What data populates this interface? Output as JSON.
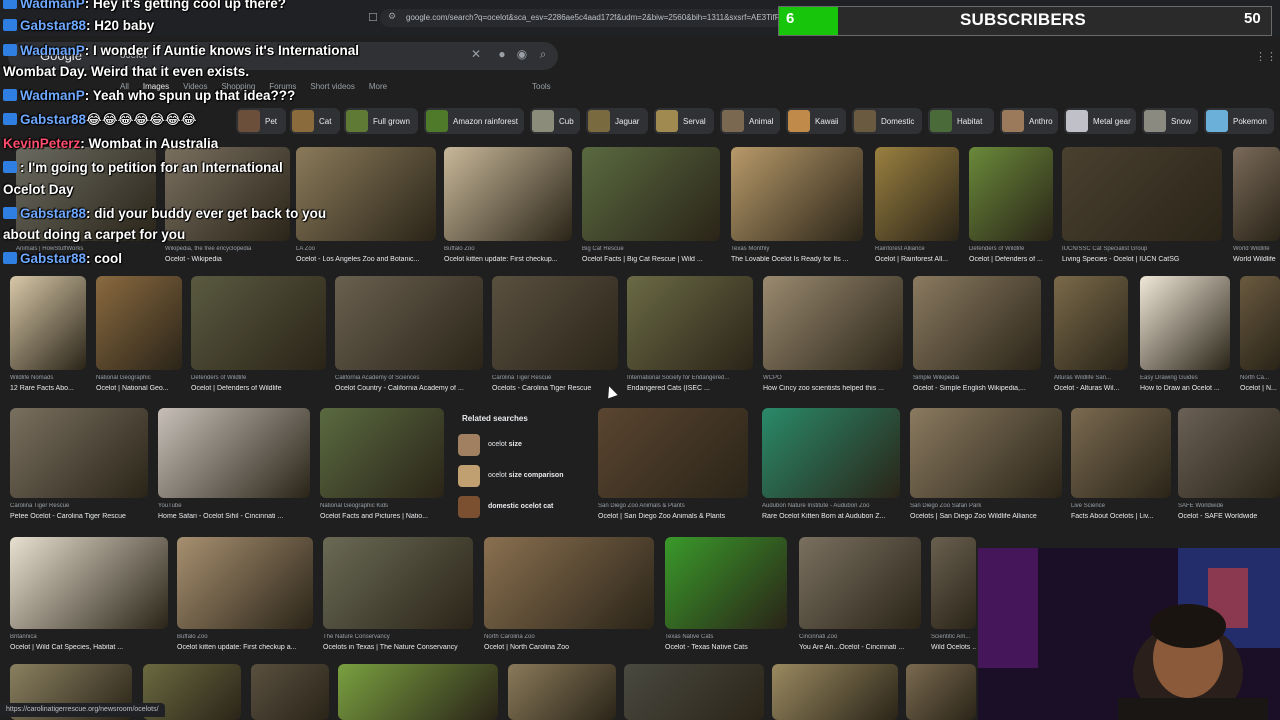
{
  "browser": {
    "url": "google.com/search?q=ocelot&sca_esv=2286ae5c4aad172f&udm=2&biw=2560&bih=1311&sxsrf=AE3TifP9aw7SG",
    "status_url": "https://carolinatigerrescue.org/newsroom/ocelots/"
  },
  "google": {
    "logo": "Google",
    "query": "ocelot",
    "tabs": [
      "All",
      "Images",
      "Videos",
      "Shopping",
      "Forums",
      "Short videos",
      "More"
    ],
    "tools": "Tools"
  },
  "chips": [
    {
      "label": "Pet",
      "color": "#6b4f3a"
    },
    {
      "label": "Cat",
      "color": "#8a6b3b"
    },
    {
      "label": "Full grown",
      "color": "#5e7a35"
    },
    {
      "label": "Amazon rainforest",
      "color": "#4f7a2a"
    },
    {
      "label": "Cub",
      "color": "#8c8c7a"
    },
    {
      "label": "Jaguar",
      "color": "#7a6a40"
    },
    {
      "label": "Serval",
      "color": "#a08a50"
    },
    {
      "label": "Animal",
      "color": "#7a6850"
    },
    {
      "label": "Kawaii",
      "color": "#c08a4a"
    },
    {
      "label": "Domestic",
      "color": "#6a5a40"
    },
    {
      "label": "Habitat",
      "color": "#4a6a3a"
    },
    {
      "label": "Anthro",
      "color": "#9a7a5a"
    },
    {
      "label": "Metal gear",
      "color": "#c0c0c8"
    },
    {
      "label": "Snow",
      "color": "#8a8a80"
    },
    {
      "label": "Pokemon",
      "color": "#6ab0d8"
    }
  ],
  "results_row1": [
    {
      "source": "Animals | HowStuffWorks",
      "caption": "",
      "color": "#6a6a60"
    },
    {
      "source": "Wikipedia, the free encyclopedia",
      "caption": "Ocelot - Wikipedia",
      "color": "#7a7060"
    },
    {
      "source": "LA Zoo",
      "caption": "Ocelot - Los Angeles Zoo and Botanic...",
      "color": "#8a7a5a"
    },
    {
      "source": "Buffalo Zoo",
      "caption": "Ocelot kitten update: First checkup...",
      "color": "#c8b89a"
    },
    {
      "source": "Big Cat Rescue",
      "caption": "Ocelot Facts | Big Cat Rescue | Wild ...",
      "color": "#5a6a40"
    },
    {
      "source": "Texas Monthly",
      "caption": "The Lovable Ocelot Is Ready for Its ...",
      "color": "#b89a6a"
    },
    {
      "source": "Rainforest Alliance",
      "caption": "Ocelot | Rainforest All...",
      "color": "#9a8040"
    },
    {
      "source": "Defenders of Wildlife",
      "caption": "Ocelot | Defenders of ...",
      "color": "#6a8a3a"
    },
    {
      "source": "IUCN/SSC Cat Specialist Group",
      "caption": "Living Species - Ocelot | IUCN CatSG",
      "color": "#4a4030"
    },
    {
      "source": "World Wildlife",
      "caption": "World Wildlife",
      "color": "#7a6a5a"
    }
  ],
  "results_row2": [
    {
      "source": "Wildlife Nomads",
      "caption": "12 Rare Facts Abo...",
      "color": "#d8c8a8"
    },
    {
      "source": "National Geographic",
      "caption": "Ocelot | National Geo...",
      "color": "#8a6a40"
    },
    {
      "source": "Defenders of Wildlife",
      "caption": "Ocelot | Defenders of Wildlife",
      "color": "#5a5a40"
    },
    {
      "source": "California Academy of Sciences",
      "caption": "Ocelot Country - California Academy of ...",
      "color": "#6a6050"
    },
    {
      "source": "Carolina Tiger Rescue",
      "caption": "Ocelots - Carolina Tiger Rescue",
      "color": "#5a5040"
    },
    {
      "source": "International Society for Endangered...",
      "caption": "Endangered Cats (ISEC ...",
      "color": "#6a6a45"
    },
    {
      "source": "WCPO",
      "caption": "How Cincy zoo scientists helped this ...",
      "color": "#9a8a70"
    },
    {
      "source": "Simple Wikipedia",
      "caption": "Ocelot - Simple English Wikipedia,...",
      "color": "#8a7a60"
    },
    {
      "source": "Alturas Wildlife San...",
      "caption": "Ocelot - Alturas Wil...",
      "color": "#7a6a4a"
    },
    {
      "source": "Easy Drawing Guides",
      "caption": "How to Draw an Ocelot ...",
      "color": "#f0e8d8"
    },
    {
      "source": "North Ca...",
      "caption": "Ocelot | N...",
      "color": "#6a5a40"
    }
  ],
  "results_row3": [
    {
      "source": "Carolina Tiger Rescue",
      "caption": "Peteе Ocelot - Carolina Tiger Rescue",
      "color": "#7a7060"
    },
    {
      "source": "YouTube",
      "caption": "Home Safari - Ocelot Sihil - Cincinnati ...",
      "color": "#c8c0b8"
    },
    {
      "source": "National Geographic Kids",
      "caption": "Ocelot Facts and Pictures | Natio...",
      "color": "#5a6a40"
    },
    {
      "source": "San Diego Zoo Animals & Plants",
      "caption": "Ocelot | San Diego Zoo Animals & Plants",
      "color": "#5a4530"
    },
    {
      "source": "Audubon Nature Institute - Audubon Zoo",
      "caption": "Rare Ocelot Kitten Born at Audubon Z...",
      "color": "#2a8a6a"
    },
    {
      "source": "San Diego Zoo Safari Park",
      "caption": "Ocelots | San Diego Zoo Wildlife Alliance",
      "color": "#8a7a60"
    },
    {
      "source": "Live Science",
      "caption": "Facts About Ocelots | Liv...",
      "color": "#7a6a50"
    },
    {
      "source": "SAFE Worldwide",
      "caption": "Ocelot - SAFE Worldwide",
      "color": "#6a6055"
    }
  ],
  "results_row4": [
    {
      "source": "Britannica",
      "caption": "Ocelot | Wild Cat Species, Habitat ...",
      "color": "#e8e0d0"
    },
    {
      "source": "Buffalo Zoo",
      "caption": "Ocelot kitten update: First checkup a...",
      "color": "#a89070"
    },
    {
      "source": "The Nature Conservancy",
      "caption": "Ocelots in Texas | The Nature Conservancy",
      "color": "#6a6a55"
    },
    {
      "source": "North Carolina Zoo",
      "caption": "Ocelot | North Carolina Zoo",
      "color": "#8a7050"
    },
    {
      "source": "Texas Native Cats",
      "caption": "Ocelot - Texas Native Cats",
      "color": "#3a9a2a"
    },
    {
      "source": "Cincinnati Zoo",
      "caption": "You Are An...Ocelot - Cincinnati ...",
      "color": "#7a7060"
    },
    {
      "source": "Scientific Am...",
      "caption": "Wild Ocelots ...",
      "color": "#6a6050"
    }
  ],
  "row5_colors": [
    "#8a8060",
    "#6a6a40",
    "#5a5040",
    "#7aa040",
    "#8a7a5a",
    "#4a4a40",
    "#9a8a60",
    "#7a6a50"
  ],
  "related": {
    "title": "Related searches",
    "items": [
      {
        "prefix": "ocelot ",
        "bold": "size",
        "color": "#a08060"
      },
      {
        "prefix": "ocelot ",
        "bold": "size comparison",
        "color": "#c0a070"
      },
      {
        "prefix": "",
        "bold": "domestic ocelot cat",
        "color": "#7a5030"
      }
    ]
  },
  "chat": [
    {
      "user": "WadmanP",
      "text": ": Hey it's getting cool up there?",
      "badge": true,
      "color": "blue"
    },
    {
      "user": "Gabstar88",
      "text": ": H20 baby",
      "badge": true,
      "color": "blue"
    },
    {
      "user": "WadmanP",
      "text": ": I wonder if Auntie knows it's International",
      "badge": true,
      "color": "blue"
    },
    {
      "user": "",
      "text": "Wombat Day. Weird that it even exists.",
      "badge": false,
      "color": "blue"
    },
    {
      "user": "WadmanP",
      "text": ": Yeah who spun up that idea???",
      "badge": true,
      "color": "blue"
    },
    {
      "user": "Gabstar88",
      "text": "😂😂😂😂😂😂😂",
      "badge": true,
      "color": "blue"
    },
    {
      "user": "KevinPeterz",
      "text": ": Wombat in Australia",
      "badge": false,
      "color": "red"
    },
    {
      "user": "",
      "text": ": I'm going to petition for an International",
      "badge": true,
      "color": "blue"
    },
    {
      "user": "",
      "text": "Ocelot Day",
      "badge": false,
      "color": "blue"
    },
    {
      "user": "Gabstar88",
      "text": ": did your buddy ever get back to you",
      "badge": true,
      "color": "blue"
    },
    {
      "user": "",
      "text": "about doing a carpet for you",
      "badge": false,
      "color": "blue"
    },
    {
      "user": "Gabstar88",
      "text": ": cool",
      "badge": true,
      "color": "blue"
    }
  ],
  "subscribers": {
    "count": "6",
    "label": "SUBSCRIBERS",
    "goal": "50",
    "progress": 0.12,
    "fill_color": "#17c60a"
  }
}
